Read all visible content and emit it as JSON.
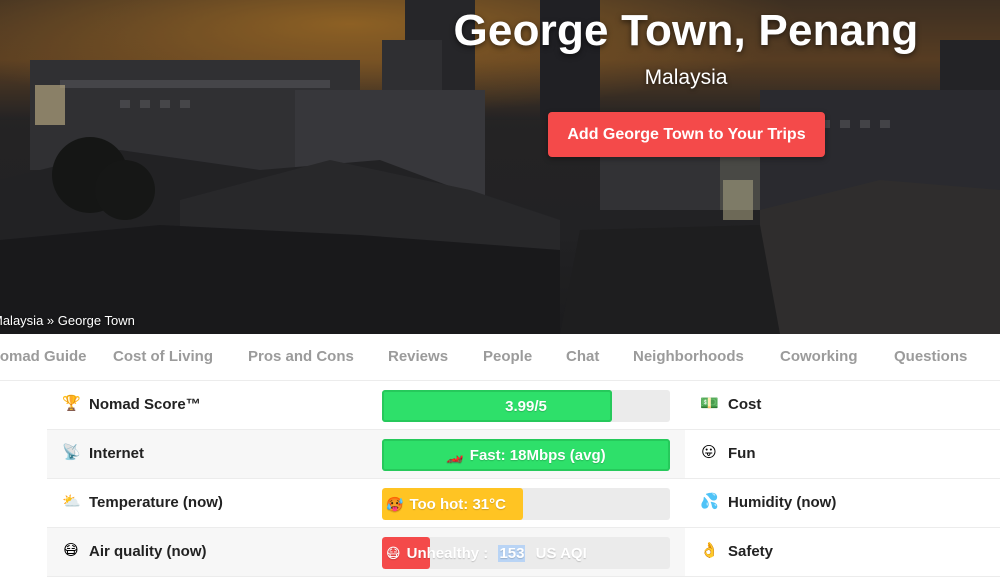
{
  "hero": {
    "title": "George Town, Penang",
    "subtitle": "Malaysia",
    "cta_label": "Add George Town to Your Trips",
    "breadcrumb": "Malaysia » George Town"
  },
  "tabs": [
    {
      "label": "Nomad Guide"
    },
    {
      "label": "Cost of Living"
    },
    {
      "label": "Pros and Cons"
    },
    {
      "label": "Reviews"
    },
    {
      "label": "People"
    },
    {
      "label": "Chat"
    },
    {
      "label": "Neighborhoods"
    },
    {
      "label": "Coworking"
    },
    {
      "label": "Questions"
    }
  ],
  "rows": [
    {
      "left_icon": "🏆",
      "left_icon_name": "trophy-icon",
      "left_label": "Nomad Score™",
      "bar_value": "3.99/5",
      "bar_fraction": 0.798,
      "bar_color": "#2ee06a",
      "right_icon": "💵",
      "right_icon_name": "money-icon",
      "right_label": "Cost"
    },
    {
      "left_icon": "📡",
      "left_icon_name": "satellite-icon",
      "left_label": "Internet",
      "bar_emoji": "🏎️",
      "bar_value": "Fast: 18Mbps (avg)",
      "bar_fraction": 1.0,
      "bar_color": "#2ee06a",
      "right_icon": "😛",
      "right_icon_name": "fun-face-icon",
      "right_label": "Fun"
    },
    {
      "left_icon": "⛅",
      "left_icon_name": "partly-cloudy-icon",
      "left_label": "Temperature (now)",
      "bar_emoji": "🥵",
      "bar_value": "Too hot: 31°C",
      "bar_fraction": 0.49,
      "bar_color": "#ffc423",
      "right_icon": "💦",
      "right_icon_name": "droplets-icon",
      "right_label": "Humidity (now)"
    },
    {
      "left_icon": "😷",
      "left_icon_name": "mask-icon",
      "left_label": "Air quality (now)",
      "bar_emoji": "😷",
      "bar_value_prefix": "Unhealthy : ",
      "bar_value_number": "153",
      "bar_value_suffix": " US AQI",
      "bar_fraction": 0.165,
      "bar_color": "#f44a4a",
      "right_icon": "👌",
      "right_icon_name": "ok-hand-icon",
      "right_label": "Safety"
    }
  ]
}
